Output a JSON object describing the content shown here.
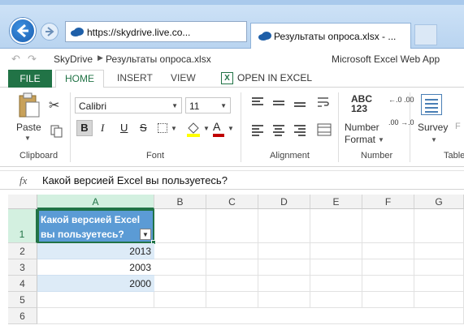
{
  "browser": {
    "address": "https://skydrive.live.co...",
    "tab_title": "Результаты опроса.xlsx - ..."
  },
  "excel": {
    "breadcrumb": {
      "home": "SkyDrive",
      "file": "Результаты опроса.xlsx"
    },
    "app_name": "Microsoft Excel Web App"
  },
  "ribbon": {
    "tabs": {
      "file": "FILE",
      "home": "HOME",
      "insert": "INSERT",
      "view": "VIEW",
      "open_in_excel": "OPEN IN EXCEL"
    },
    "clipboard": {
      "label": "Clipboard",
      "paste": "Paste"
    },
    "font": {
      "label": "Font",
      "name": "Calibri",
      "size": "11",
      "bold": "B",
      "italic": "I",
      "underline": "U",
      "strike": "S",
      "font_color_glyph": "A"
    },
    "alignment": {
      "label": "Alignment"
    },
    "number": {
      "label": "Number",
      "abc": "ABC",
      "digits": "123",
      "number_label": "Number",
      "format_label": "Format",
      "inc_decimal": "←.0 .00",
      "dec_decimal": ".00 →.0"
    },
    "tables": {
      "label": "Table",
      "survey": "Survey",
      "format_partial": "F"
    }
  },
  "formula_bar": {
    "fx": "fx",
    "content": "Какой версией Excel вы пользуетесь?"
  },
  "grid": {
    "columns": [
      "A",
      "B",
      "C",
      "D",
      "E",
      "F",
      "G"
    ],
    "rows": [
      "1",
      "2",
      "3",
      "4",
      "5",
      "6"
    ],
    "header_cell": "Какой версией Excel вы пользуетесь?",
    "values": [
      "2013",
      "2003",
      "2000"
    ]
  },
  "colors": {
    "excel_green": "#217346",
    "table_header": "#5b9bd5",
    "table_band": "#ddebf7"
  }
}
